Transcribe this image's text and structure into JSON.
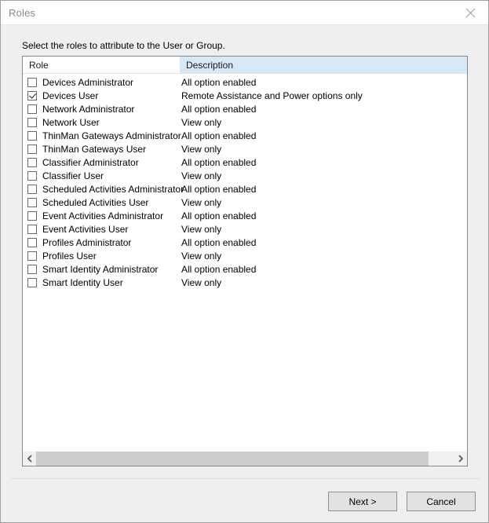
{
  "window": {
    "title": "Roles",
    "close_icon": "close-icon"
  },
  "instruction": "Select the roles to attribute to the User or Group.",
  "list": {
    "columns": [
      {
        "key": "role",
        "label": "Role"
      },
      {
        "key": "description",
        "label": "Description"
      }
    ],
    "rows": [
      {
        "checked": false,
        "role": "Devices Administrator",
        "description": "All option enabled"
      },
      {
        "checked": true,
        "role": "Devices User",
        "description": "Remote Assistance and Power options only"
      },
      {
        "checked": false,
        "role": "Network Administrator",
        "description": "All option enabled"
      },
      {
        "checked": false,
        "role": "Network User",
        "description": "View only"
      },
      {
        "checked": false,
        "role": "ThinMan Gateways Administrator",
        "description": "All option enabled"
      },
      {
        "checked": false,
        "role": "ThinMan Gateways User",
        "description": "View only"
      },
      {
        "checked": false,
        "role": "Classifier Administrator",
        "description": "All option enabled"
      },
      {
        "checked": false,
        "role": "Classifier User",
        "description": "View only"
      },
      {
        "checked": false,
        "role": "Scheduled Activities Administrator",
        "description": "All option enabled"
      },
      {
        "checked": false,
        "role": "Scheduled Activities User",
        "description": "View only"
      },
      {
        "checked": false,
        "role": "Event Activities Administrator",
        "description": "All option enabled"
      },
      {
        "checked": false,
        "role": "Event Activities User",
        "description": "View only"
      },
      {
        "checked": false,
        "role": "Profiles Administrator",
        "description": "All option enabled"
      },
      {
        "checked": false,
        "role": "Profiles User",
        "description": "View only"
      },
      {
        "checked": false,
        "role": "Smart Identity Administrator",
        "description": "All option enabled"
      },
      {
        "checked": false,
        "role": "Smart Identity User",
        "description": "View only"
      }
    ],
    "scrollbar": {
      "left_arrow_icon": "chevron-left-icon",
      "right_arrow_icon": "chevron-right-icon",
      "thumb_width_percent": 94
    }
  },
  "footer": {
    "next_label": "Next >",
    "cancel_label": "Cancel"
  },
  "colors": {
    "header_highlight": "#d7e8f7",
    "dialog_background": "#efefef",
    "list_background": "#ffffff",
    "button_face": "#e2e2e2",
    "scroll_thumb": "#cdcdcd"
  }
}
